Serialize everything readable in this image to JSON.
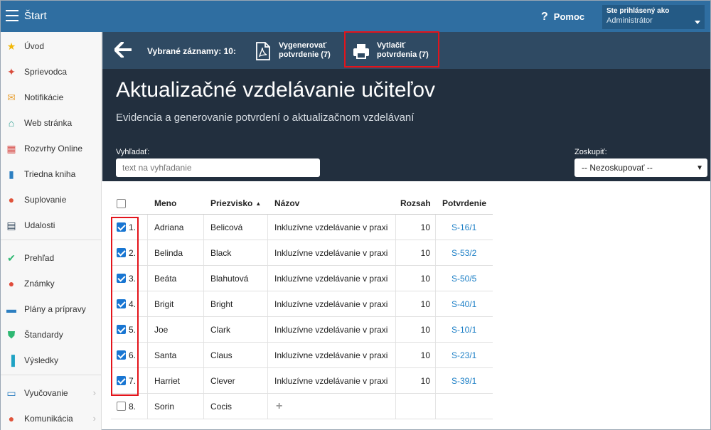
{
  "topbar": {
    "title": "Štart",
    "help_label": "Pomoc",
    "user_line1": "Ste prihlásený ako",
    "user_line2": "Administrátor"
  },
  "sidebar": {
    "items": [
      {
        "label": "Úvod",
        "icon": "star-icon"
      },
      {
        "label": "Sprievodca",
        "icon": "magic-wand-icon"
      },
      {
        "label": "Notifikácie",
        "icon": "envelope-icon"
      },
      {
        "label": "Web stránka",
        "icon": "home-icon"
      },
      {
        "label": "Rozvrhy Online",
        "icon": "calendar-grid-icon"
      },
      {
        "label": "Triedna kniha",
        "icon": "book-icon"
      },
      {
        "label": "Suplovanie",
        "icon": "person-icon"
      },
      {
        "label": "Udalosti",
        "icon": "calendar-icon"
      },
      {
        "label": "Prehľad",
        "icon": "check-circle-icon"
      },
      {
        "label": "Známky",
        "icon": "grades-icon"
      },
      {
        "label": "Plány a prípravy",
        "icon": "briefcase-icon"
      },
      {
        "label": "Štandardy",
        "icon": "shield-check-icon"
      },
      {
        "label": "Výsledky",
        "icon": "bar-chart-icon"
      },
      {
        "label": "Vyučovanie",
        "icon": "open-book-icon"
      },
      {
        "label": "Komunikácia",
        "icon": "chat-icon"
      }
    ]
  },
  "toolbar": {
    "selected_label": "Vybrané záznamy: 10:",
    "generate_l1": "Vygenerovať",
    "generate_l2": "potvrdenie (7)",
    "print_l1": "Vytlačiť",
    "print_l2": "potvrdenia (7)"
  },
  "header": {
    "title": "Aktualizačné vzdelávanie učiteľov",
    "subtitle": "Evidencia a generovanie potvrdení o aktualizačnom vzdelávaní",
    "search_label": "Vyhľadať:",
    "search_placeholder": "text na vyhľadanie",
    "group_label": "Zoskupiť:",
    "group_value": "-- Nezoskupovať --"
  },
  "table": {
    "headers": {
      "meno": "Meno",
      "priezvisko": "Priezvisko",
      "nazov": "Názov",
      "rozsah": "Rozsah",
      "potvrdenie": "Potvrdenie"
    },
    "rows": [
      {
        "num": "1.",
        "checked": true,
        "meno": "Adriana",
        "priezvisko": "Belicová",
        "nazov": "Inkluzívne vzdelávanie v praxi",
        "rozsah": "10",
        "potvrdenie": "S-16/1"
      },
      {
        "num": "2.",
        "checked": true,
        "meno": "Belinda",
        "priezvisko": "Black",
        "nazov": "Inkluzívne vzdelávanie v praxi",
        "rozsah": "10",
        "potvrdenie": "S-53/2"
      },
      {
        "num": "3.",
        "checked": true,
        "meno": "Beáta",
        "priezvisko": "Blahutová",
        "nazov": "Inkluzívne vzdelávanie v praxi",
        "rozsah": "10",
        "potvrdenie": "S-50/5"
      },
      {
        "num": "4.",
        "checked": true,
        "meno": "Brigit",
        "priezvisko": "Bright",
        "nazov": "Inkluzívne vzdelávanie v praxi",
        "rozsah": "10",
        "potvrdenie": "S-40/1"
      },
      {
        "num": "5.",
        "checked": true,
        "meno": "Joe",
        "priezvisko": "Clark",
        "nazov": "Inkluzívne vzdelávanie v praxi",
        "rozsah": "10",
        "potvrdenie": "S-10/1"
      },
      {
        "num": "6.",
        "checked": true,
        "meno": "Santa",
        "priezvisko": "Claus",
        "nazov": "Inkluzívne vzdelávanie v praxi",
        "rozsah": "10",
        "potvrdenie": "S-23/1"
      },
      {
        "num": "7.",
        "checked": true,
        "meno": "Harriet",
        "priezvisko": "Clever",
        "nazov": "Inkluzívne vzdelávanie v praxi",
        "rozsah": "10",
        "potvrdenie": "S-39/1"
      },
      {
        "num": "8.",
        "checked": false,
        "meno": "Sorin",
        "priezvisko": "Cocis",
        "nazov": "+",
        "rozsah": "",
        "potvrdenie": ""
      }
    ]
  },
  "colors": {
    "topbar": "#2f6ea1",
    "toolbar": "#2f4a63",
    "header": "#222f3e",
    "highlight": "#e3141b",
    "link": "#1c7fc6",
    "checkbox": "#1976d2"
  }
}
